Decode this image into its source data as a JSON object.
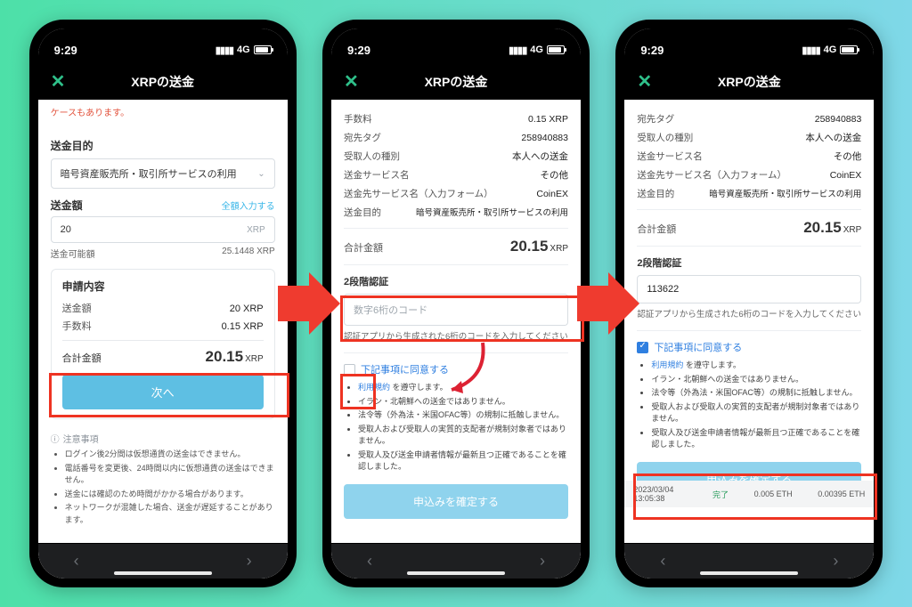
{
  "status": {
    "time": "9:29",
    "net": "4G"
  },
  "header": {
    "title": "XRPの送金"
  },
  "screen1": {
    "warning_tail": "ケースもあります。",
    "purpose_label": "送金目的",
    "purpose_value": "暗号資産販売所・取引所サービスの利用",
    "amount_label": "送金額",
    "full_input": "全額入力する",
    "amount_value": "20",
    "amount_unit": "XRP",
    "avail_label": "送金可能額",
    "avail_value": "25.1448 XRP",
    "summary_title": "申請内容",
    "row_amount_k": "送金額",
    "row_amount_v": "20 XRP",
    "row_fee_k": "手数料",
    "row_fee_v": "0.15 XRP",
    "total_label": "合計金額",
    "total_value": "20.15",
    "total_unit": "XRP",
    "next_btn": "次へ",
    "notes_title": "注意事項",
    "notes": [
      "ログイン後2分間は仮想通貨の送金はできません。",
      "電話番号を変更後、24時間以内に仮想通貨の送金はできません。",
      "送金には確認のため時間がかかる場合があります。",
      "ネットワークが混雑した場合、送金が遅延することがあります。"
    ]
  },
  "screen2": {
    "fee_k": "手数料",
    "fee_v": "0.15 XRP",
    "tag_k": "宛先タグ",
    "tag_v": "258940883",
    "recip_k": "受取人の種別",
    "recip_v": "本人への送金",
    "svc_k": "送金サービス名",
    "svc_v": "その他",
    "dest_k": "送金先サービス名（入力フォーム）",
    "dest_v": "CoinEX",
    "purpose_k": "送金目的",
    "purpose_v": "暗号資産販売所・取引所サービスの利用",
    "total_label": "合計金額",
    "total_value": "20.15",
    "total_unit": "XRP",
    "section_2fa": "2段階認証",
    "code_placeholder": "数字6桁のコード",
    "code_help": "認証アプリから生成された6桁のコードを入力してください",
    "agree_head": "下記事項に同意する",
    "agree_items": [
      "利用規約 を遵守します。",
      "イラン・北朝鮮への送金ではありません。",
      "法令等（外為法・米国OFAC等）の規制に抵触しません。",
      "受取人および受取人の実質的支配者が規制対象者ではありません。",
      "受取人及び送金申請者情報が最新且つ正確であることを確認しました。"
    ],
    "confirm_btn": "申込みを確定する"
  },
  "screen3": {
    "tag_k": "宛先タグ",
    "tag_v": "258940883",
    "recip_k": "受取人の種別",
    "recip_v": "本人への送金",
    "svc_k": "送金サービス名",
    "svc_v": "その他",
    "dest_k": "送金先サービス名（入力フォーム）",
    "dest_v": "CoinEX",
    "purpose_k": "送金目的",
    "purpose_v": "暗号資産販売所・取引所サービスの利用",
    "total_label": "合計金額",
    "total_value": "20.15",
    "total_unit": "XRP",
    "section_2fa": "2段階認証",
    "code_value": "113622",
    "code_help": "認証アプリから生成された6桁のコードを入力してください",
    "agree_head": "下記事項に同意する",
    "agree_items": [
      "利用規約 を遵守します。",
      "イラン・北朝鮮への送金ではありません。",
      "法令等（外為法・米国OFAC等）の規制に抵触しません。",
      "受取人および受取人の実質的支配者が規制対象者ではありません。",
      "受取人及び送金申請者情報が最新且つ正確であることを確認しました。"
    ],
    "confirm_btn": "申込みを確定する",
    "bg_date": "2023/03/04 13:05:38",
    "bg_status": "完了",
    "bg_amount": "0.005 ETH",
    "bg_amount2": "0.00395 ETH"
  }
}
